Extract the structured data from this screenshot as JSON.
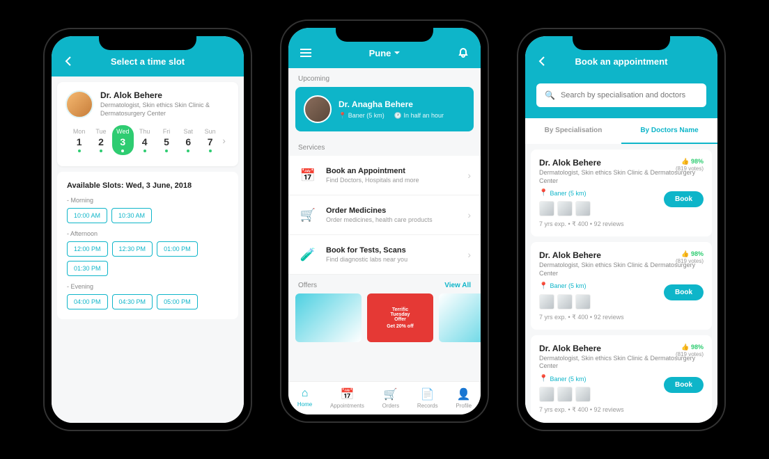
{
  "phone1": {
    "header_title": "Select a time slot",
    "doctor": {
      "name": "Dr. Alok Behere",
      "subtitle": "Dermatologist, Skin ethics Skin Clinic & Dermatosurgery Center"
    },
    "days": [
      {
        "label": "Mon",
        "num": "1"
      },
      {
        "label": "Tue",
        "num": "2"
      },
      {
        "label": "Wed",
        "num": "3",
        "selected": true
      },
      {
        "label": "Thu",
        "num": "4"
      },
      {
        "label": "Fri",
        "num": "5"
      },
      {
        "label": "Sat",
        "num": "6"
      },
      {
        "label": "Sun",
        "num": "7"
      }
    ],
    "available_title": "Available Slots: Wed, 3 June, 2018",
    "periods": {
      "morning_label": "- Morning",
      "morning_slots": [
        "10:00 AM",
        "10:30 AM"
      ],
      "afternoon_label": "- Afternoon",
      "afternoon_slots": [
        "12:00 PM",
        "12:30 PM",
        "01:00 PM",
        "01:30 PM"
      ],
      "evening_label": "- Evening",
      "evening_slots": [
        "04:00 PM",
        "04:30 PM",
        "05:00 PM"
      ]
    }
  },
  "phone2": {
    "location": "Pune",
    "upcoming_label": "Upcoming",
    "upcoming": {
      "name": "Dr. Anagha Behere",
      "place": "Baner (5 km)",
      "time": "In half an hour"
    },
    "services_label": "Services",
    "services": [
      {
        "title": "Book an Appointment",
        "sub": "Find Doctors, Hospitals and more"
      },
      {
        "title": "Order Medicines",
        "sub": "Order medicines, health care products"
      },
      {
        "title": "Book for Tests, Scans",
        "sub": "Find diagnostic labs near you"
      }
    ],
    "offers_label": "Offers",
    "view_all": "View All",
    "offer2_line1": "Terrific",
    "offer2_line2": "Tuesday",
    "offer2_line3": "Offer",
    "offer2_line4": "Get 20% off",
    "nav": [
      "Home",
      "Appointments",
      "Orders",
      "Records",
      "Profile"
    ]
  },
  "phone3": {
    "header_title": "Book an appointment",
    "search_placeholder": "Search by specialisation and doctors",
    "tabs": {
      "spec": "By Specialisation",
      "name": "By Doctors Name"
    },
    "doctor": {
      "name": "Dr. Alok Behere",
      "sub": "Dermatologist, Skin ethics Skin Clinic & Dermatosurgery Center",
      "rating": "98%",
      "votes": "(819 votes)",
      "loc": "Baner (5 km)",
      "meta": "7 yrs exp.  •  ₹ 400  •  92 reviews",
      "book_label": "Book"
    }
  }
}
